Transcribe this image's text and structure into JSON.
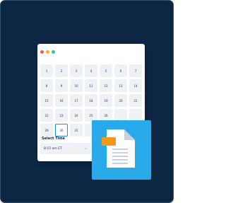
{
  "colors": {
    "background": "#0d2643",
    "dot_red": "#f25b3c",
    "dot_yellow": "#f5b11c",
    "dot_teal": "#24c6b9",
    "selected_border": "#1d8fd6",
    "badge": "#29a9ea",
    "doc_tab": "#f59a1e"
  },
  "window_dots": [
    "red",
    "yellow",
    "teal"
  ],
  "calendar": {
    "rows": [
      [
        "1",
        "2",
        "3",
        "4",
        "5",
        "6",
        "7"
      ],
      [
        "8",
        "9",
        "10",
        "11",
        "12",
        "13",
        "14"
      ],
      [
        "15",
        "16",
        "17",
        "18",
        "19",
        "20",
        "21"
      ],
      [
        "22",
        "23",
        "24",
        "25",
        "26",
        "",
        ""
      ],
      [
        "29",
        "30",
        "31",
        "",
        "",
        "",
        ""
      ]
    ],
    "selected_day": "30"
  },
  "time_picker": {
    "label": "Select Time",
    "value": "8:15 am ET",
    "chevron_icon": "chevron-down-icon"
  },
  "badge": {
    "icon": "document-icon"
  }
}
